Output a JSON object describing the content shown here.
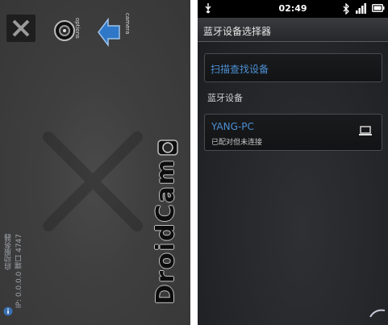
{
  "left_app": {
    "options_label": "options",
    "camera_label": "camera",
    "logo_text": "DroidCam",
    "status_line_1": "启动服务器",
    "status_line_2": "IP: 0.0.0.0 端口 4747"
  },
  "right_app": {
    "statusbar": {
      "time": "02:49"
    },
    "title": "蓝牙设备选择器",
    "scan_button": "扫描查找设备",
    "section_label": "蓝牙设备",
    "device": {
      "name": "YANG-PC",
      "state": "已配对但未连接"
    }
  },
  "colors": {
    "accent_blue": "#4c8fd4",
    "arrow_blue": "#2f78c8",
    "left_bg": "#3f3f3f",
    "right_bg": "#24262a"
  },
  "icons": [
    "close-icon",
    "options-camera-icon",
    "rotate-camera-arrow-icon",
    "droidcam-camera-icon",
    "info-icon",
    "usb-icon",
    "bluetooth-icon",
    "signal-icon",
    "battery-icon",
    "laptop-icon"
  ]
}
